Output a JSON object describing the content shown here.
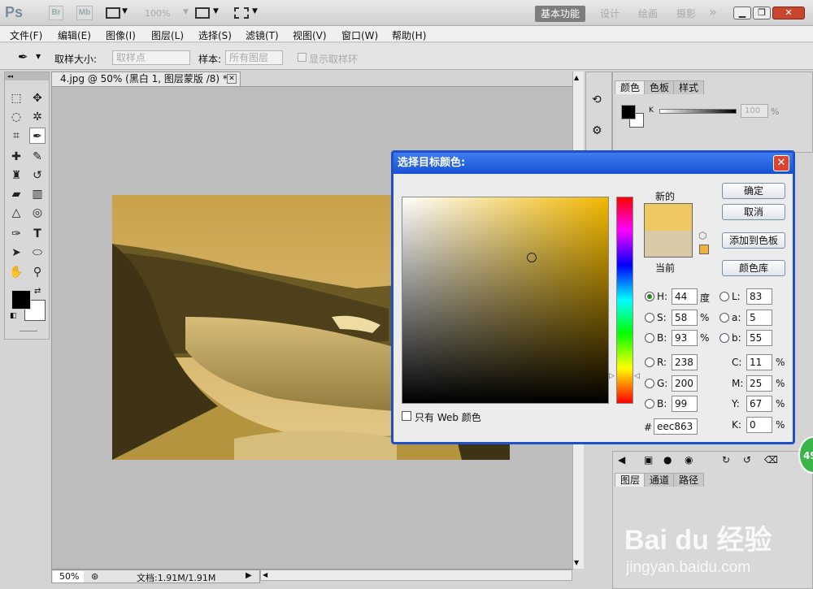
{
  "app": {
    "logo": "Ps",
    "title_buttons": [
      "Br",
      "Mb"
    ],
    "zoom_readout": "100%",
    "workspaces": [
      "基本功能",
      "设计",
      "绘画",
      "摄影"
    ],
    "more": "»"
  },
  "menu": [
    "文件(F)",
    "编辑(E)",
    "图像(I)",
    "图层(L)",
    "选择(S)",
    "滤镜(T)",
    "视图(V)",
    "窗口(W)",
    "帮助(H)"
  ],
  "options": {
    "sample_size_label": "取样大小:",
    "sample_size_value": "取样点",
    "sample_label": "样本:",
    "sample_value": "所有图层",
    "show_ring_label": "显示取样环"
  },
  "document": {
    "tab_title": "4.jpg @ 50% (黑白 1, 图层蒙版 /8) *",
    "zoom": "50%",
    "doc_info": "文档:1.91M/1.91M"
  },
  "color_panel": {
    "tabs": [
      "颜色",
      "色板",
      "样式"
    ],
    "k_label": "K",
    "k_value": "100",
    "k_unit": "%"
  },
  "layers_panel": {
    "tabs": [
      "图层",
      "通道",
      "路径"
    ]
  },
  "dialog": {
    "title": "选择目标颜色:",
    "close": "✕",
    "new_label": "新的",
    "current_label": "当前",
    "new_color": "#eec863",
    "current_color": "#d9c9a6",
    "buttons": {
      "ok": "确定",
      "cancel": "取消",
      "add_swatch": "添加到色板",
      "library": "颜色库"
    },
    "hsb": [
      {
        "label": "H:",
        "value": "44",
        "unit": "度"
      },
      {
        "label": "S:",
        "value": "58",
        "unit": "%"
      },
      {
        "label": "B:",
        "value": "93",
        "unit": "%"
      }
    ],
    "rgb": [
      {
        "label": "R:",
        "value": "238"
      },
      {
        "label": "G:",
        "value": "200"
      },
      {
        "label": "B:",
        "value": "99"
      }
    ],
    "lab": [
      {
        "label": "L:",
        "value": "83"
      },
      {
        "label": "a:",
        "value": "5"
      },
      {
        "label": "b:",
        "value": "55"
      }
    ],
    "cmyk": [
      {
        "label": "C:",
        "value": "11",
        "unit": "%"
      },
      {
        "label": "M:",
        "value": "25",
        "unit": "%"
      },
      {
        "label": "Y:",
        "value": "67",
        "unit": "%"
      },
      {
        "label": "K:",
        "value": "0",
        "unit": "%"
      }
    ],
    "hex_label": "#",
    "hex_value": "eec863",
    "web_only_label": "只有 Web 颜色"
  },
  "badge": "49",
  "watermark": {
    "main": "Bai du 经验",
    "sub": "jingyan.baidu.com"
  }
}
